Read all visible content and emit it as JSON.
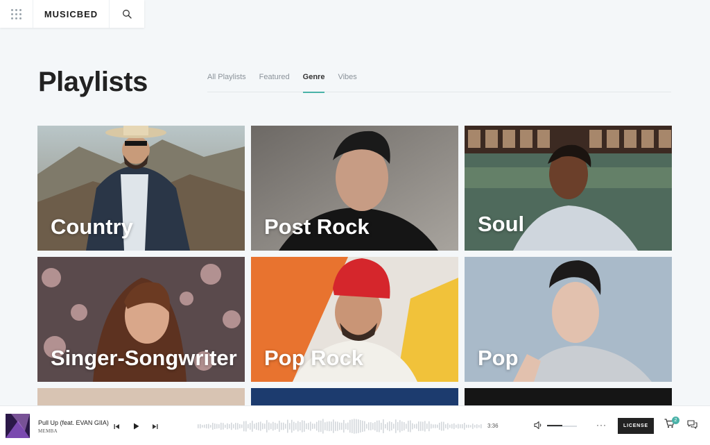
{
  "brand": {
    "logo_text": "MUSICBED"
  },
  "icons": {
    "menu": "grid-dots-icon",
    "search": "search-icon",
    "prev": "skip-back-icon",
    "play": "play-icon",
    "next": "skip-forward-icon",
    "volume": "volume-icon",
    "cart": "cart-icon",
    "chat": "chat-icon"
  },
  "page": {
    "title": "Playlists"
  },
  "tabs": [
    {
      "label": "All Playlists",
      "active": false
    },
    {
      "label": "Featured",
      "active": false
    },
    {
      "label": "Genre",
      "active": true
    },
    {
      "label": "Vibes",
      "active": false
    }
  ],
  "playlists": [
    {
      "label": "Country"
    },
    {
      "label": "Post Rock"
    },
    {
      "label": "Soul"
    },
    {
      "label": "Singer-Songwriter"
    },
    {
      "label": "Pop Rock"
    },
    {
      "label": "Pop"
    }
  ],
  "player": {
    "track_title": "Pull Up (feat. EVAN GIIA)",
    "artist": "MEMBA",
    "duration": "3:36",
    "volume": 0.5,
    "more_label": "···",
    "license_label": "LICENSE",
    "cart_count": "2"
  },
  "colors": {
    "accent": "#4ab2a8",
    "background": "#f4f7f9",
    "dark": "#222222"
  }
}
